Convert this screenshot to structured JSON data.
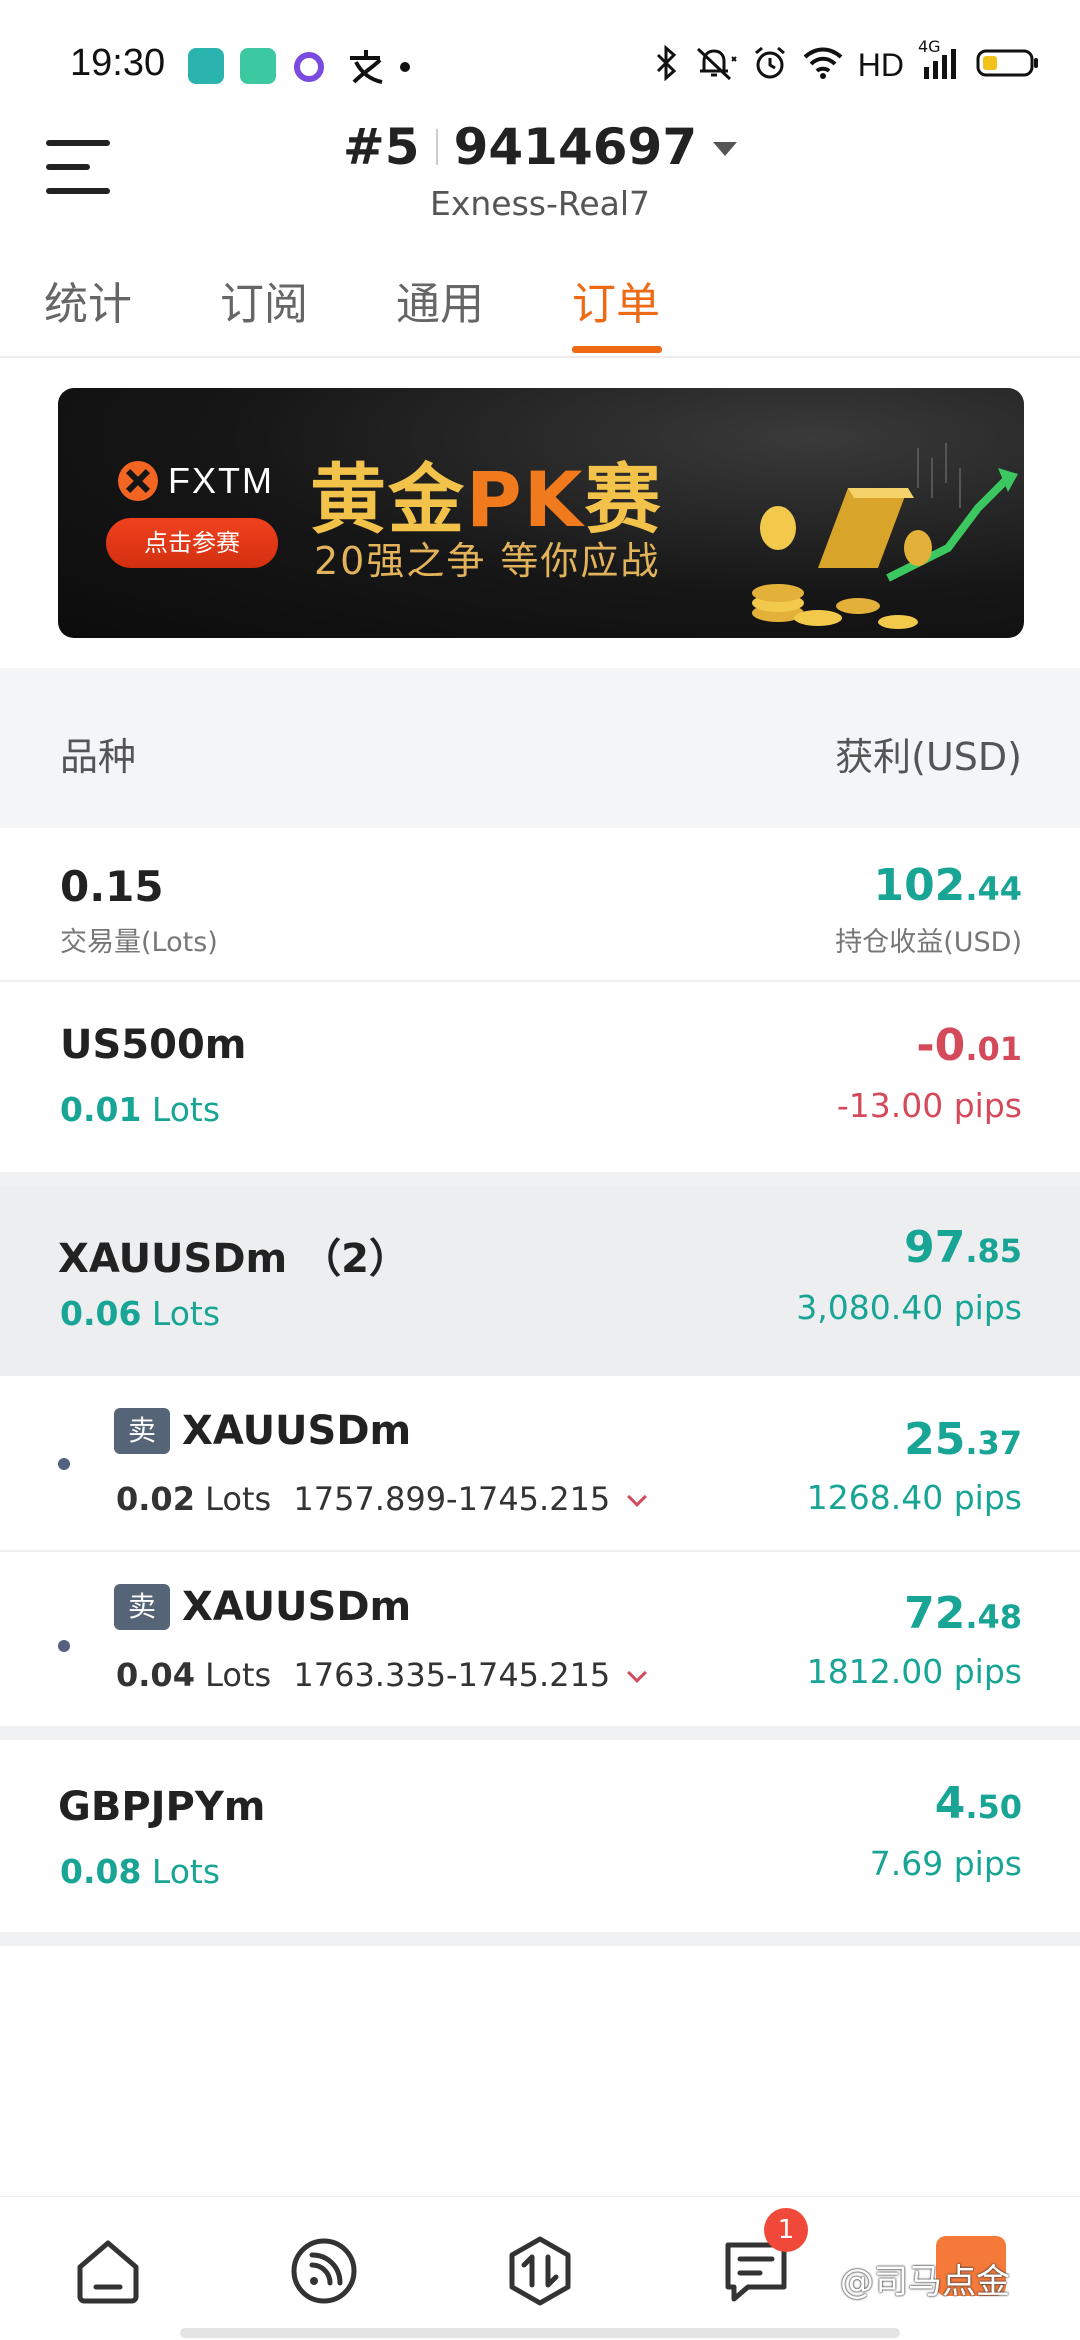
{
  "status_bar": {
    "time": "19:30",
    "apps": [
      "boss-app-icon",
      "phone-app-icon",
      "assistant-app-icon",
      "alipay-icon"
    ],
    "network": "HD",
    "signal": "4G",
    "icons": [
      "bluetooth-icon",
      "mute-icon",
      "alarm-icon",
      "wifi-icon",
      "signal-icon",
      "battery-icon"
    ]
  },
  "header": {
    "account_prefix": "#5",
    "account_number": "9414697",
    "server": "Exness-Real7"
  },
  "tabs": [
    {
      "label": "统计",
      "active": false
    },
    {
      "label": "订阅",
      "active": false
    },
    {
      "label": "通用",
      "active": false
    },
    {
      "label": "订单",
      "active": true
    }
  ],
  "banner": {
    "brand": "FXTM",
    "button": "点击参赛",
    "title_a": "黄金",
    "title_pk": "PK",
    "title_b": "赛",
    "subtitle": "20强之争  等你应战"
  },
  "list_header": {
    "left": "品种",
    "right": "获利(USD)"
  },
  "summary": {
    "volume": "0.15",
    "volume_label": "交易量(Lots)",
    "profit_int": "102",
    "profit_dec": ".44",
    "profit_label": "持仓收益(USD)"
  },
  "positions": [
    {
      "symbol": "US500m",
      "lots_value": "0.01",
      "lots_unit": "Lots",
      "pl_int": "-0",
      "pl_dec": ".01",
      "pips": "-13.00 pips",
      "color": "#d44a5a"
    },
    {
      "symbol": "XAUUSDm （2）",
      "lots_value": "0.06",
      "lots_unit": "Lots",
      "pl_int": "97",
      "pl_dec": ".85",
      "pips": "3,080.40 pips",
      "color": "#19a596"
    },
    {
      "symbol": "GBPJPYm",
      "lots_value": "0.08",
      "lots_unit": "Lots",
      "pl_int": "4",
      "pl_dec": ".50",
      "pips": "7.69 pips",
      "color": "#19a596"
    }
  ],
  "orders": [
    {
      "side": "卖",
      "symbol": "XAUUSDm",
      "lots": "0.02",
      "lots_unit": "Lots",
      "prices": "1757.899-1745.215",
      "pl_int": "25",
      "pl_dec": ".37",
      "pips": "1268.40 pips"
    },
    {
      "side": "卖",
      "symbol": "XAUUSDm",
      "lots": "0.04",
      "lots_unit": "Lots",
      "prices": "1763.335-1745.215",
      "pl_int": "72",
      "pl_dec": ".48",
      "pips": "1812.00 pips"
    }
  ],
  "bottom_nav": {
    "items": [
      "home-icon",
      "signal-feed-icon",
      "trade-icon",
      "orders-icon",
      "profile-icon"
    ],
    "badge": "1",
    "watermark": "@司马点金"
  }
}
